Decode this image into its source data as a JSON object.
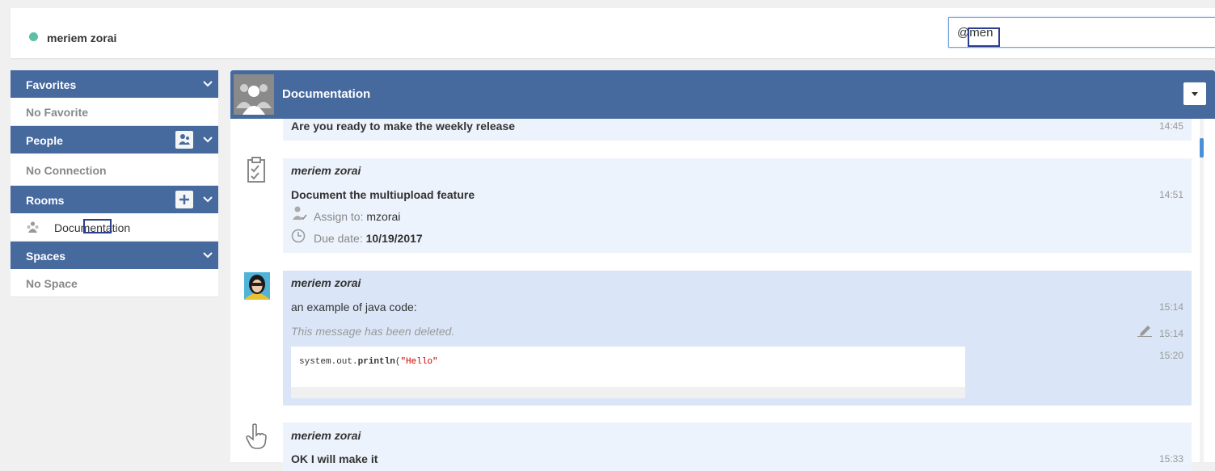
{
  "topbar": {
    "user_name": "meriem zorai",
    "status_color": "#5bc0a5",
    "search_value": "@men"
  },
  "sidebar": {
    "favorites": {
      "title": "Favorites",
      "empty_text": "No Favorite"
    },
    "people": {
      "title": "People",
      "empty_text": "No Connection",
      "action_icon": "add-contact-icon"
    },
    "rooms": {
      "title": "Rooms",
      "action_icon": "plus-icon",
      "items": [
        {
          "label": "Documentation",
          "icon": "group-icon"
        }
      ]
    },
    "spaces": {
      "title": "Spaces",
      "empty_text": "No Space"
    }
  },
  "room": {
    "title": "Documentation",
    "dropdown_icon": "caret-down-icon"
  },
  "messages": [
    {
      "text": "Are you ready to make the weekly release",
      "time": "14:45"
    },
    {
      "author": "meriem zorai",
      "icon": "task-clipboard-icon",
      "title": "Document the multiupload feature",
      "time": "14:51",
      "assign_label": "Assign to:",
      "assign_value": "mzorai",
      "due_label": "Due date:",
      "due_value": "10/19/2017"
    },
    {
      "author": "meriem zorai",
      "icon": "user-avatar",
      "lines": [
        {
          "text": "an example of java code:",
          "time": "15:14"
        },
        {
          "text": "This message has been deleted.",
          "time": "15:14"
        },
        {
          "code_prefix": "system.out.",
          "code_method": "println",
          "code_open": "(",
          "code_string": "\"Hello\"",
          "time": "15:20"
        }
      ]
    },
    {
      "author": "meriem zorai",
      "icon": "hand-pointer-icon",
      "text": "OK I will make it",
      "time": "15:33"
    }
  ],
  "colors": {
    "header": "#46699e",
    "accent": "#4a90d9",
    "message_bg": "#edf3fc",
    "message_bg_selected": "#dae6f7"
  }
}
